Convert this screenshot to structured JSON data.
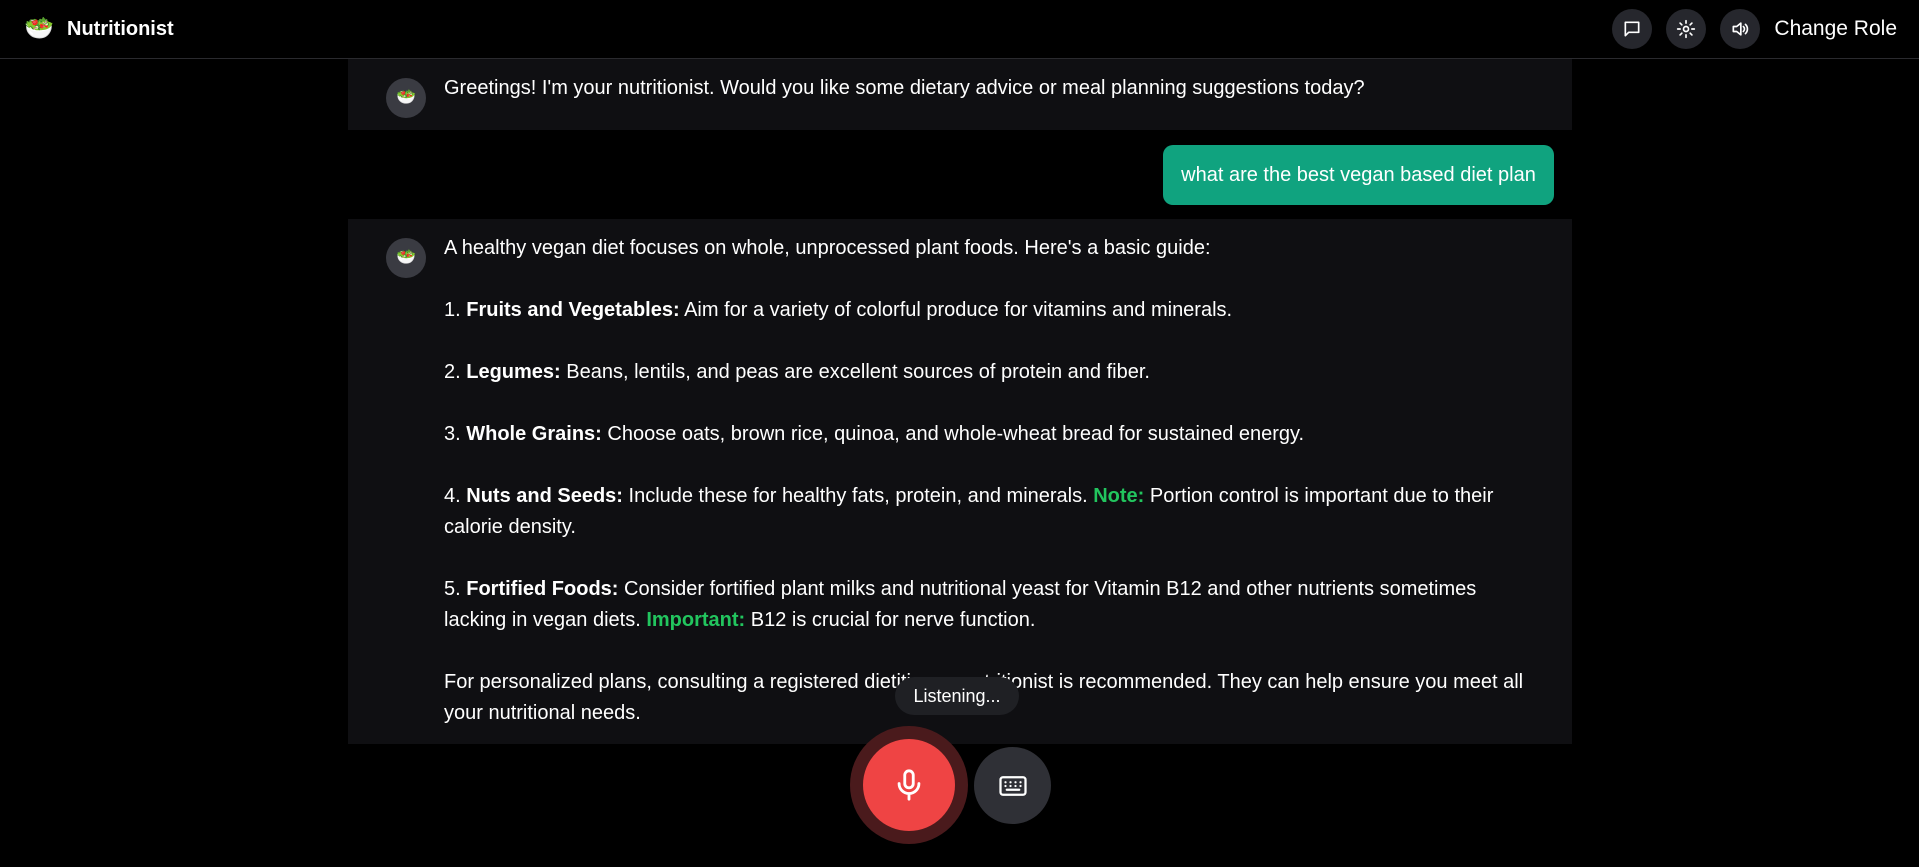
{
  "header": {
    "logo_icon": "salad-bowl-icon",
    "logo_glyph": "🥗",
    "title": "Nutritionist",
    "actions": [
      {
        "name": "chat-icon"
      },
      {
        "name": "gear-icon"
      },
      {
        "name": "speaker-icon"
      }
    ],
    "change_role_label": "Change Role"
  },
  "conversation": {
    "greeting": {
      "avatar_glyph": "🥗",
      "text": "Greetings! I'm your nutritionist. Would you like some dietary advice or meal planning suggestions today?"
    },
    "user_message": "what are the best vegan based diet plan",
    "reply": {
      "avatar_glyph": "🥗",
      "intro": "A healthy vegan diet focuses on whole, unprocessed plant foods.  Here's a basic guide:",
      "items": [
        {
          "num": "1.",
          "title": "Fruits and Vegetables:",
          "text": " Aim for a variety of colorful produce for vitamins and minerals."
        },
        {
          "num": "2.",
          "title": "Legumes:",
          "text": " Beans, lentils, and peas are excellent sources of protein and fiber."
        },
        {
          "num": "3.",
          "title": "Whole Grains:",
          "text": " Choose oats, brown rice, quinoa, and whole-wheat bread for sustained energy."
        },
        {
          "num": "4.",
          "title": "Nuts and Seeds:",
          "text": " Include these for healthy fats, protein, and minerals.  ",
          "note_label": "Note:",
          "note_text": " Portion control is important due to their calorie density."
        },
        {
          "num": "5.",
          "title": "Fortified Foods:",
          "text": "  Consider fortified plant milks and nutritional yeast for Vitamin B12 and other nutrients sometimes lacking in vegan diets.  ",
          "note_label": "Important:",
          "note_text": " B12 is crucial for nerve function."
        }
      ],
      "closing": "For personalized plans, consulting a registered dietitian or nutritionist is recommended.  They can help ensure you meet all your nutritional needs."
    }
  },
  "voice": {
    "status": "Listening...",
    "mic_icon": "microphone-icon",
    "keyboard_icon": "keyboard-icon"
  },
  "colors": {
    "accent_user_bubble": "#10a37f",
    "highlight": "#22c55e",
    "mic_active": "#ef4444",
    "background": "#000000"
  }
}
